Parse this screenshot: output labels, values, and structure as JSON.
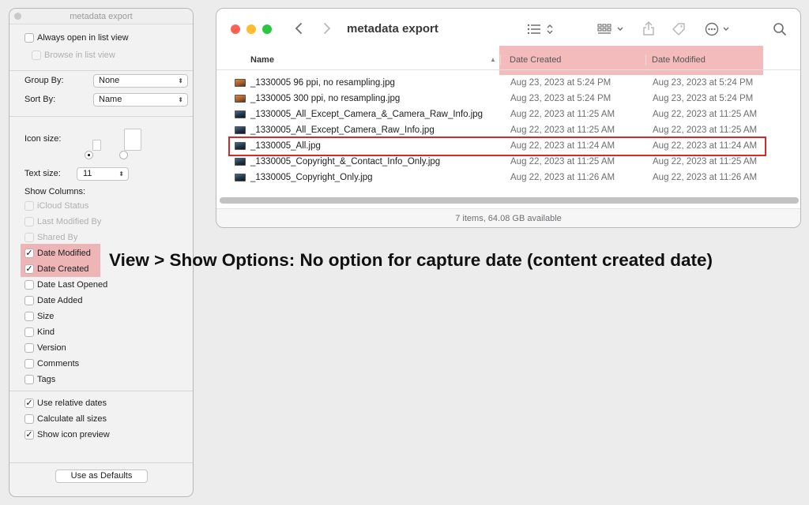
{
  "options_panel": {
    "title": "metadata export",
    "always_open_list_view": {
      "label": "Always open in list view",
      "checked": false
    },
    "browse_in_list_view": {
      "label": "Browse in list view",
      "checked": false,
      "enabled": false
    },
    "group_by": {
      "label": "Group By:",
      "value": "None"
    },
    "sort_by": {
      "label": "Sort By:",
      "value": "Name"
    },
    "icon_size": {
      "label": "Icon size:",
      "selected": "small"
    },
    "text_size": {
      "label": "Text size:",
      "value": "11"
    },
    "show_columns_label": "Show Columns:",
    "columns": [
      {
        "label": "iCloud Status",
        "checked": false,
        "enabled": false
      },
      {
        "label": "Last Modified By",
        "checked": false,
        "enabled": false
      },
      {
        "label": "Shared By",
        "checked": false,
        "enabled": false
      },
      {
        "label": "Date Modified",
        "checked": true,
        "enabled": true
      },
      {
        "label": "Date Created",
        "checked": true,
        "enabled": true
      },
      {
        "label": "Date Last Opened",
        "checked": false,
        "enabled": true
      },
      {
        "label": "Date Added",
        "checked": false,
        "enabled": true
      },
      {
        "label": "Size",
        "checked": false,
        "enabled": true
      },
      {
        "label": "Kind",
        "checked": false,
        "enabled": true
      },
      {
        "label": "Version",
        "checked": false,
        "enabled": true
      },
      {
        "label": "Comments",
        "checked": false,
        "enabled": true
      },
      {
        "label": "Tags",
        "checked": false,
        "enabled": true
      }
    ],
    "options": [
      {
        "label": "Use relative dates",
        "checked": true
      },
      {
        "label": "Calculate all sizes",
        "checked": false
      },
      {
        "label": "Show icon preview",
        "checked": true
      }
    ],
    "defaults_button": "Use as Defaults",
    "check_glyph": "✓"
  },
  "finder": {
    "title": "metadata export",
    "columns": {
      "name": "Name",
      "created": "Date Created",
      "modified": "Date Modified"
    },
    "files": [
      {
        "name": "_1330005 96 ppi, no resampling.jpg",
        "created": "Aug 23, 2023 at 5:24 PM",
        "modified": "Aug 23, 2023 at 5:24 PM",
        "thumb": "warm"
      },
      {
        "name": "_1330005 300 ppi, no resampling.jpg",
        "created": "Aug 23, 2023 at 5:24 PM",
        "modified": "Aug 23, 2023 at 5:24 PM",
        "thumb": "warm"
      },
      {
        "name": "_1330005_All_Except_Camera_&_Camera_Raw_Info.jpg",
        "created": "Aug 22, 2023 at 11:25 AM",
        "modified": "Aug 22, 2023 at 11:25 AM",
        "thumb": "dark"
      },
      {
        "name": "_1330005_All_Except_Camera_Raw_Info.jpg",
        "created": "Aug 22, 2023 at 11:25 AM",
        "modified": "Aug 22, 2023 at 11:25 AM",
        "thumb": "dark"
      },
      {
        "name": "_1330005_All.jpg",
        "created": "Aug 22, 2023 at 11:24 AM",
        "modified": "Aug 22, 2023 at 11:24 AM",
        "thumb": "dark"
      },
      {
        "name": "_1330005_Copyright_&_Contact_Info_Only.jpg",
        "created": "Aug 22, 2023 at 11:25 AM",
        "modified": "Aug 22, 2023 at 11:25 AM",
        "thumb": "dark"
      },
      {
        "name": "_1330005_Copyright_Only.jpg",
        "created": "Aug 22, 2023 at 11:26 AM",
        "modified": "Aug 22, 2023 at 11:26 AM",
        "thumb": "dark"
      }
    ],
    "status": "7 items, 64.08 GB available",
    "icons": {
      "back": "chevron-left-icon",
      "forward": "chevron-right-icon",
      "list_view": "list-view-icon",
      "grid_view": "grid-view-icon",
      "share": "share-icon",
      "tag": "tag-icon",
      "more": "ellipsis-circle-icon",
      "search": "search-icon"
    },
    "colors": {
      "close": "#fe5f57",
      "minimize": "#febc2e",
      "zoom": "#28c840",
      "highlight": "#e87878",
      "outline": "#d42a2a"
    }
  },
  "caption": "View > Show Options: No option for capture date (content created date)"
}
